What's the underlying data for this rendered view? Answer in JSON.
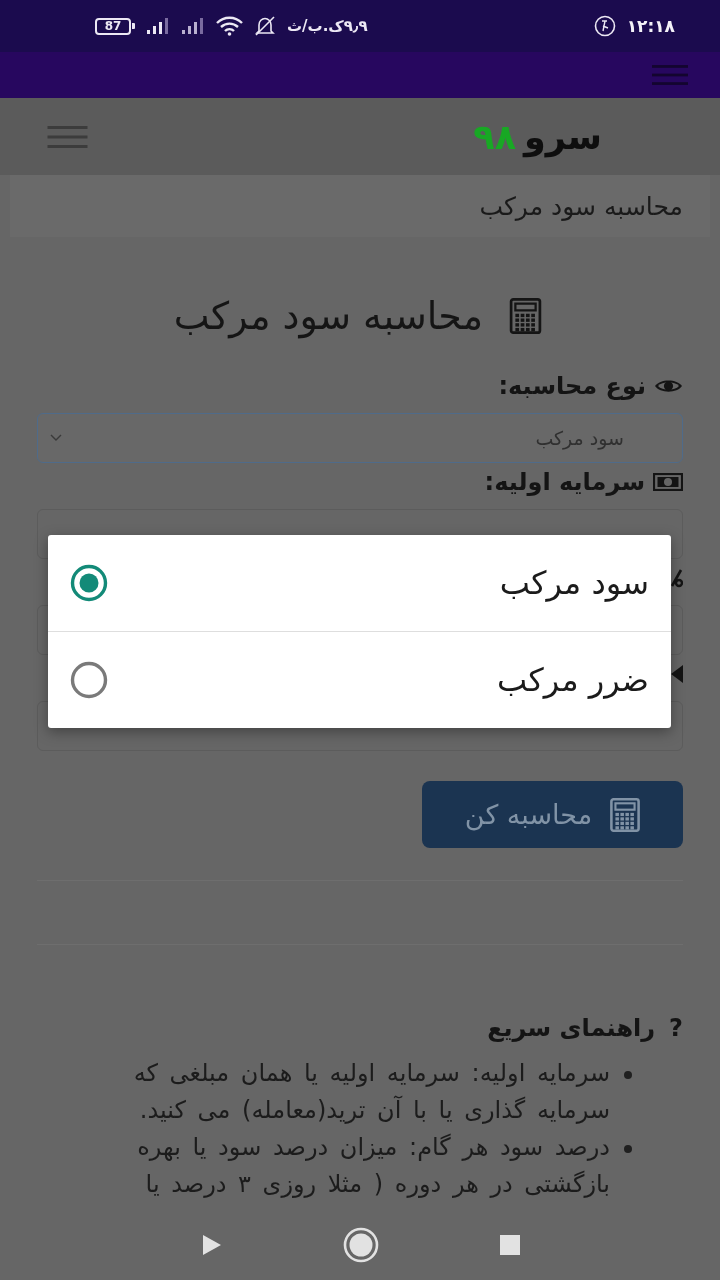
{
  "status_bar": {
    "battery": "87",
    "network_speed": "۹٫۹ک.ب/ث",
    "time": "۱۲:۱۸"
  },
  "header": {
    "logo_name": "سرو",
    "logo_number": "۹۸"
  },
  "breadcrumb": "محاسبه سود مرکب",
  "calculator": {
    "title": "محاسبه سود مرکب",
    "fields": [
      {
        "kind": "select",
        "label": "نوع محاسبه:",
        "value": "سود مرکب",
        "focused": true
      },
      {
        "kind": "input",
        "label": "سرمایه اولیه:"
      },
      {
        "kind": "input"
      },
      {
        "kind": "input"
      }
    ],
    "submit": "محاسبه کن"
  },
  "guide": {
    "marker": "?",
    "title": "راهنمای سریع",
    "items": [
      "سرمایه اولیه: سرمایه اولیه یا همان مبلغی که سرمایه گذاری یا با آن ترید(معامله) می کنید.",
      "درصد سود هر گام: میزان درصد سود یا بهره بازگشتی در هر دوره ( مثلا روزی ۳ درصد یا"
    ]
  },
  "dialog": {
    "options": [
      {
        "label": "سود مرکب",
        "selected": true
      },
      {
        "label": "ضرر مرکب",
        "selected": false
      }
    ]
  }
}
